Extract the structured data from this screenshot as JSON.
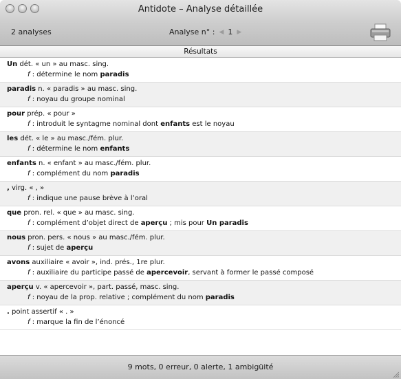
{
  "window": {
    "title": "Antidote – Analyse détaillée"
  },
  "toolbar": {
    "analysis_count": "2 analyses",
    "analysis_label": "Analyse n° :",
    "analysis_number": "1"
  },
  "results": {
    "header": "Résultats",
    "entries": [
      {
        "word": "Un",
        "desc": " dét. « un » au masc. sing.",
        "func": [
          ": détermine le nom ",
          {
            "b": "paradis"
          }
        ]
      },
      {
        "word": "paradis",
        "desc": " n. « paradis » au masc. sing.",
        "func": [
          ": noyau du groupe nominal"
        ]
      },
      {
        "word": "pour",
        "desc": " prép. « pour »",
        "func": [
          ": introduit le syntagme nominal dont ",
          {
            "b": "enfants"
          },
          " est le noyau"
        ]
      },
      {
        "word": "les",
        "desc": " dét. « le » au masc./fém. plur.",
        "func": [
          ": détermine le nom ",
          {
            "b": "enfants"
          }
        ]
      },
      {
        "word": "enfants",
        "desc": " n. « enfant » au masc./fém. plur.",
        "func": [
          ": complément du nom ",
          {
            "b": "paradis"
          }
        ]
      },
      {
        "word": ",",
        "desc": " virg. « , »",
        "func": [
          ": indique une pause brève à l’oral"
        ]
      },
      {
        "word": "que",
        "desc": " pron. rel. « que » au masc. sing.",
        "func": [
          ": complément d’objet direct de ",
          {
            "b": "aperçu"
          },
          " ; mis pour ",
          {
            "b": "Un paradis"
          }
        ]
      },
      {
        "word": "nous",
        "desc": " pron. pers. « nous » au masc./fém. plur.",
        "func": [
          ": sujet de ",
          {
            "b": "aperçu"
          }
        ]
      },
      {
        "word": "avons",
        "desc": " auxiliaire « avoir », ind. prés., 1re plur.",
        "func": [
          ": auxiliaire du participe passé de ",
          {
            "b": "apercevoir"
          },
          ", servant à former le passé composé"
        ]
      },
      {
        "word": "aperçu",
        "desc": " v. « apercevoir », part. passé, masc. sing.",
        "func": [
          ": noyau de la prop. relative ; complément du nom ",
          {
            "b": "paradis"
          }
        ]
      },
      {
        "word": ".",
        "desc": " point assertif « . »",
        "func": [
          ": marque la fin de l’énoncé"
        ]
      }
    ],
    "function_letter": "f"
  },
  "status": {
    "summary": "9 mots, 0 erreur, 0 alerte, 1 ambigüité"
  }
}
